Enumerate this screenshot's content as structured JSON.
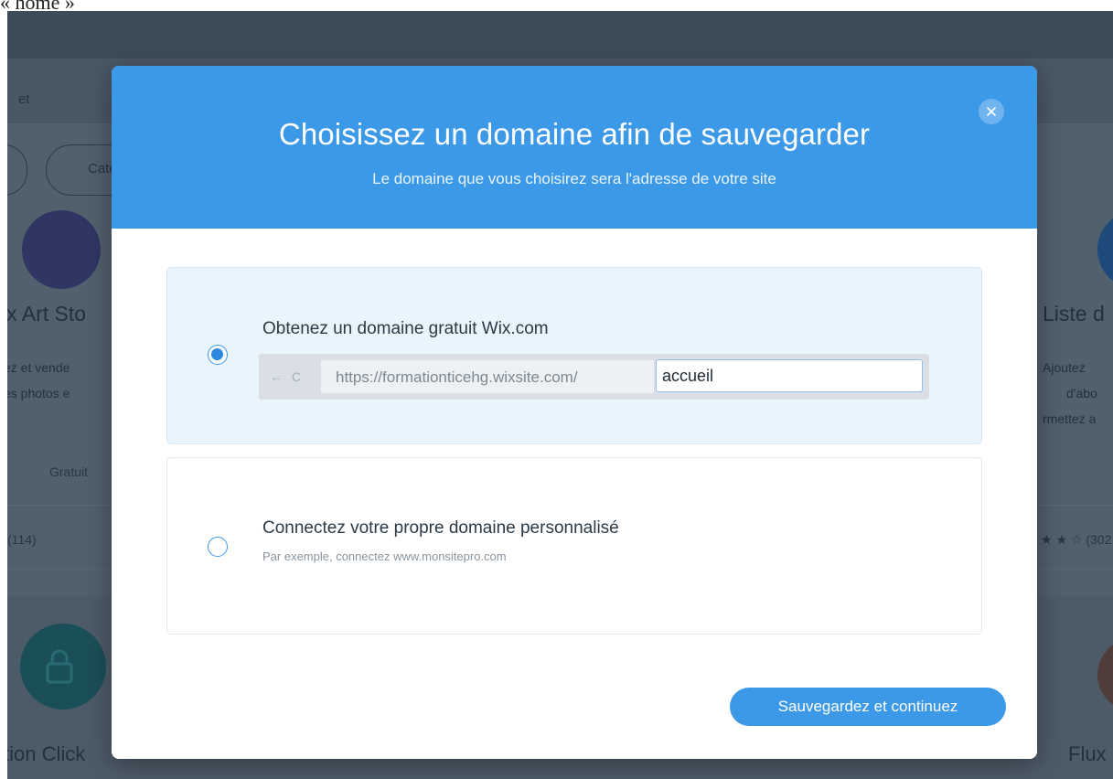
{
  "caption": "« home »",
  "background": {
    "search_text": "et",
    "filter_pill_text": "Cate",
    "cards": [
      {
        "title": "ix Art Sto",
        "lines": [
          "ez et vende",
          "es photos e"
        ],
        "price": "Gratuit",
        "rating": "(114)"
      },
      {
        "title": "Liste d",
        "lines": [
          "Ajoutez",
          "d'abo",
          "rmettez a"
        ],
        "rating": "(302"
      }
    ],
    "bottom_titles": [
      "tion Click",
      "Flux"
    ]
  },
  "modal": {
    "title": "Choisissez un domaine afin de sauvegarder",
    "subtitle": "Le domaine que vous choisirez sera l'adresse de votre site",
    "close_icon": "close-icon",
    "options": {
      "free": {
        "title": "Obtenez un domaine gratuit Wix.com",
        "selected": true,
        "nav_glyphs": "← C",
        "url_prefix": "https://formationticehg.wixsite.com/",
        "url_value": "accueil"
      },
      "custom": {
        "title": "Connectez votre propre domaine personnalisé",
        "description": "Par exemple, connectez www.monsitepro.com",
        "selected": false
      }
    },
    "save_label": "Sauvegardez et continuez"
  },
  "colors": {
    "accent": "#3c99e8",
    "overlay": "#51606d",
    "selected_option_bg": "#e9f4fd"
  }
}
